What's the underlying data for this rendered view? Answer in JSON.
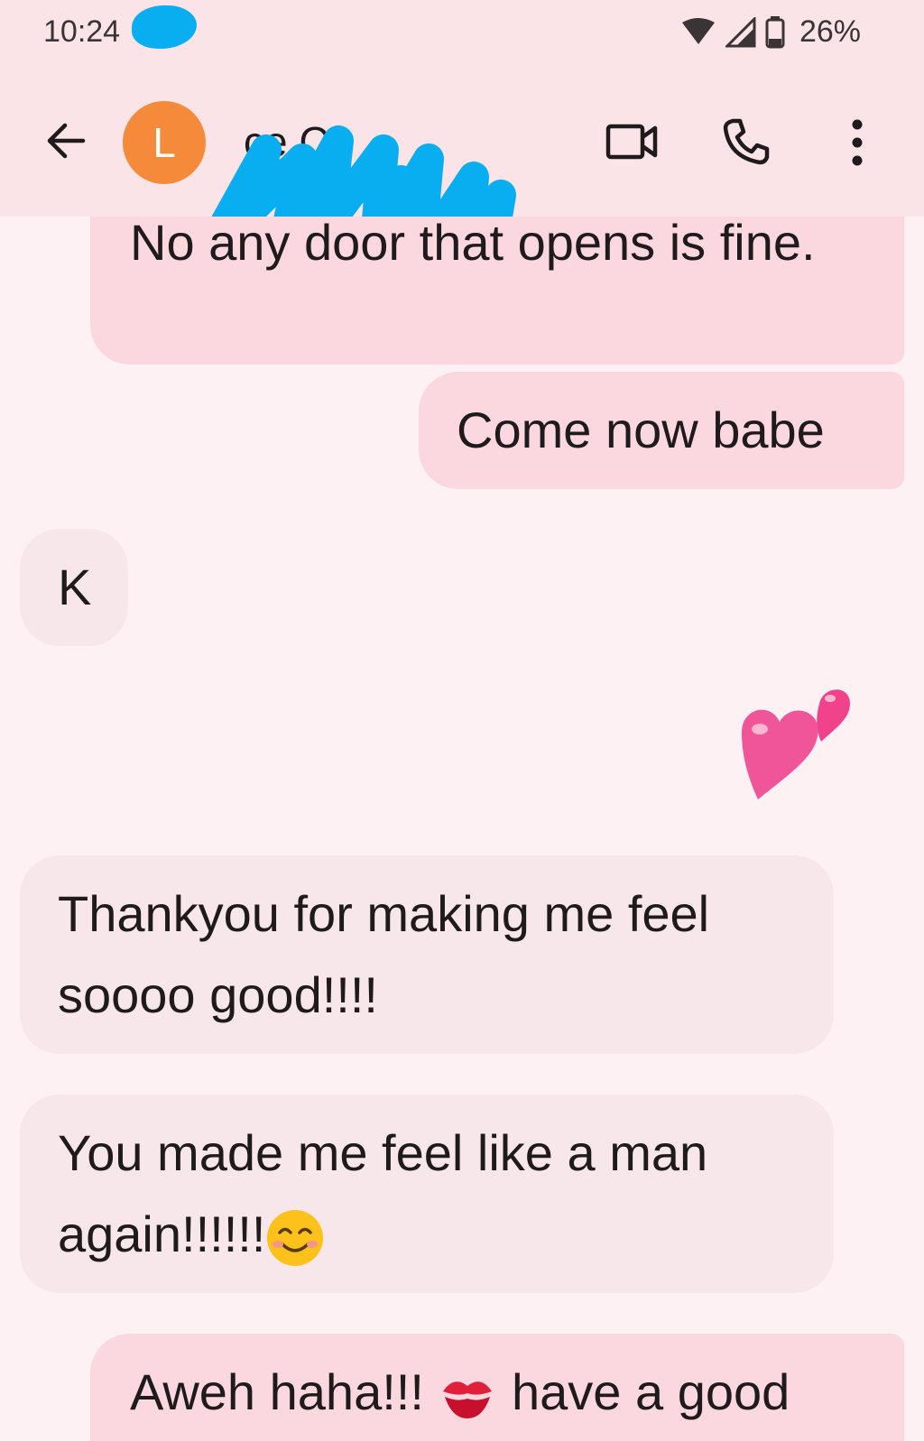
{
  "status_bar": {
    "time": "10:24",
    "battery": "26%"
  },
  "header": {
    "avatar_letter": "L",
    "contact_name_partial": "ce C",
    "icons": [
      "back-arrow-icon",
      "video-call-icon",
      "phone-icon",
      "more-vert-icon"
    ]
  },
  "messages": [
    {
      "direction": "outgoing",
      "text": "No any door that opens is fine."
    },
    {
      "direction": "outgoing",
      "text": "Come now babe"
    },
    {
      "direction": "incoming",
      "text": "K"
    },
    {
      "direction": "outgoing",
      "emoji": "two-hearts"
    },
    {
      "direction": "incoming",
      "text": "Thankyou for making me feel soooo good!!!!"
    },
    {
      "direction": "incoming",
      "text": "You made me feel like a man again!!!!!!",
      "emoji": "smiling-face"
    },
    {
      "direction": "outgoing",
      "text_before": "Aweh haha!!!",
      "emoji": "kiss-mark",
      "text_after": "have a good"
    }
  ],
  "colors": {
    "header_bg": "#fbe4e8",
    "thread_bg": "#fdf1f3",
    "outgoing_bubble": "#fbd7df",
    "incoming_bubble": "#f7e7ea",
    "avatar": "#f58a3b",
    "redaction": "#08aef0"
  }
}
